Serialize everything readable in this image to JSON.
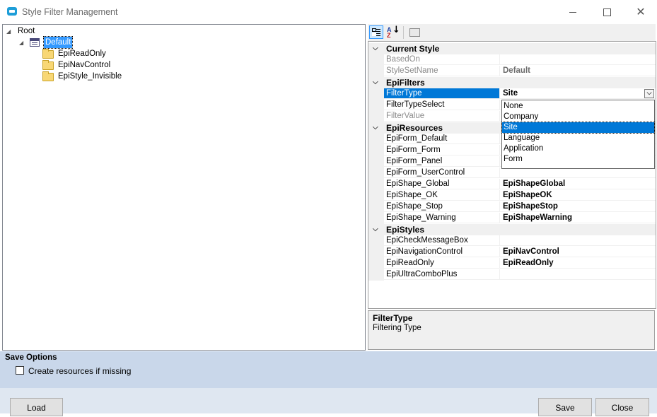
{
  "window": {
    "title": "Style Filter Management"
  },
  "tree": {
    "root": "Root",
    "default": "Default",
    "children": [
      "EpiReadOnly",
      "EpiNavControl",
      "EpiStyle_Invisible"
    ]
  },
  "toolbar": {
    "az_top": "A",
    "az_bottom": "Z"
  },
  "grid": {
    "categories": {
      "current_style": "Current Style",
      "epi_filters": "EpiFilters",
      "epi_resources": "EpiResources",
      "epi_styles": "EpiStyles"
    },
    "current_style": [
      {
        "name": "BasedOn",
        "value": ""
      },
      {
        "name": "StyleSetName",
        "value": "Default"
      }
    ],
    "epi_filters": [
      {
        "name": "FilterType",
        "value": "Site"
      },
      {
        "name": "FilterTypeSelect",
        "value": ""
      },
      {
        "name": "FilterValue",
        "value": ""
      }
    ],
    "epi_resources": [
      {
        "name": "EpiForm_Default",
        "value": ""
      },
      {
        "name": "EpiForm_Form",
        "value": ""
      },
      {
        "name": "EpiForm_Panel",
        "value": ""
      },
      {
        "name": "EpiForm_UserControl",
        "value": ""
      },
      {
        "name": "EpiShape_Global",
        "value": "EpiShapeGlobal"
      },
      {
        "name": "EpiShape_OK",
        "value": "EpiShapeOK"
      },
      {
        "name": "EpiShape_Stop",
        "value": "EpiShapeStop"
      },
      {
        "name": "EpiShape_Warning",
        "value": "EpiShapeWarning"
      }
    ],
    "epi_styles": [
      {
        "name": "EpiCheckMessageBox",
        "value": ""
      },
      {
        "name": "EpiNavigationControl",
        "value": "EpiNavControl"
      },
      {
        "name": "EpiReadOnly",
        "value": "EpiReadOnly"
      },
      {
        "name": "EpiUltraComboPlus",
        "value": ""
      }
    ]
  },
  "dropdown": {
    "options": [
      "None",
      "Company",
      "Site",
      "Language",
      "Application",
      "Form"
    ],
    "selected": "Site"
  },
  "help": {
    "title": "FilterType",
    "description": "Filtering Type"
  },
  "save_options": {
    "title": "Save Options",
    "checkbox_label": "Create resources if missing",
    "checked": false
  },
  "buttons": {
    "load": "Load",
    "save": "Save",
    "close": "Close"
  }
}
